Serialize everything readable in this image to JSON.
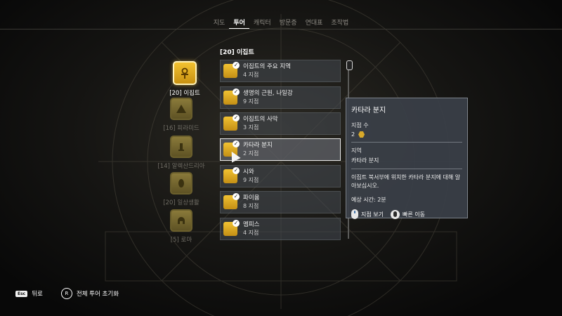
{
  "nav": {
    "tabs": [
      "지도",
      "투어",
      "캐릭터",
      "방문증",
      "연대표",
      "조작법"
    ],
    "active": "투어"
  },
  "categories": [
    {
      "label": "[20] 이집트",
      "active": true,
      "icon": "ankh-badge-icon"
    },
    {
      "label": "[16] 피라미드",
      "active": false,
      "icon": "pyramid-badge-icon"
    },
    {
      "label": "[14] 알렉산드리아",
      "active": false,
      "icon": "lighthouse-badge-icon"
    },
    {
      "label": "[20] 일상생활",
      "active": false,
      "icon": "pharaoh-badge-icon"
    },
    {
      "label": "[5] 로마",
      "active": false,
      "icon": "helmet-badge-icon"
    }
  ],
  "list": {
    "title": "[20] 이집트",
    "items": [
      {
        "name": "이집트의 주요 지역",
        "count": "4 지점"
      },
      {
        "name": "생명의 근원, 나일강",
        "count": "9 지점"
      },
      {
        "name": "이집트의 사막",
        "count": "3 지점"
      },
      {
        "name": "카타라 분지",
        "count": "2 지점"
      },
      {
        "name": "시와",
        "count": "9 지점"
      },
      {
        "name": "파이윰",
        "count": "8 지점"
      },
      {
        "name": "멤피스",
        "count": "4 지점"
      }
    ],
    "selected_index": 3
  },
  "detail": {
    "title": "카타라 분지",
    "points_label": "지점 수",
    "points_value": "2",
    "region_label": "지역",
    "region_value": "카타라 분지",
    "description": "이집트 북서부에 위치한 카타라 분지에 대해 알아보십시오.",
    "time": "예상 시간: 2분",
    "action_view": "지점 보기",
    "action_travel": "빠른 이동"
  },
  "bottom": {
    "esc_key": "Esc",
    "back": "뒤로",
    "r_key": "R",
    "reset": "전체 투어 초기화"
  },
  "colors": {
    "gold": "#f1c232",
    "panel": "#3a4048",
    "accent_white": "#ffffff"
  }
}
